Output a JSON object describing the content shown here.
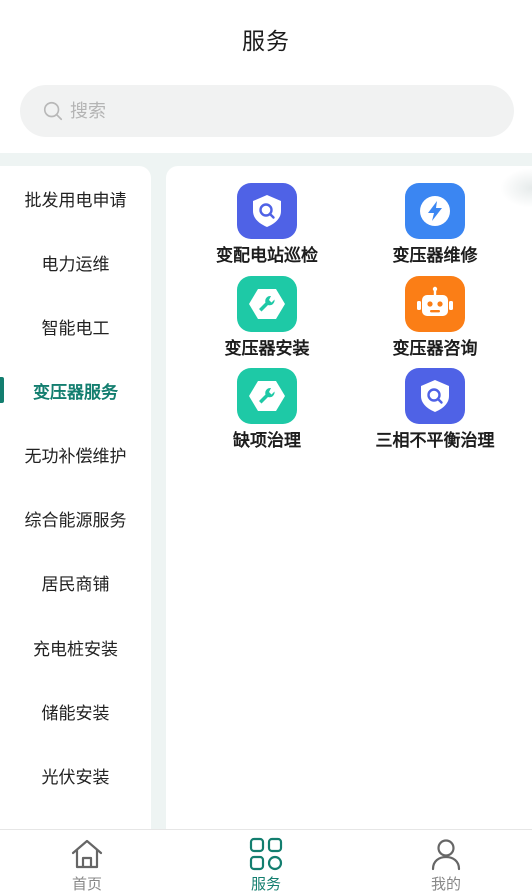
{
  "header": {
    "title": "服务"
  },
  "search": {
    "placeholder": "搜索",
    "value": ""
  },
  "sidebar": {
    "items": [
      {
        "label": "批发用电申请"
      },
      {
        "label": "电力运维"
      },
      {
        "label": "智能电工"
      },
      {
        "label": "变压器服务",
        "active": true
      },
      {
        "label": "无功补偿维护"
      },
      {
        "label": "综合能源服务"
      },
      {
        "label": "居民商铺"
      },
      {
        "label": "充电桩安装"
      },
      {
        "label": "储能安装"
      },
      {
        "label": "光伏安装"
      }
    ]
  },
  "services": [
    {
      "label": "变配电站巡检",
      "icon": "shield-search-icon",
      "color": "#4f62e6"
    },
    {
      "label": "变压器维修",
      "icon": "lightning-icon",
      "color": "#3b86f2"
    },
    {
      "label": "变压器安装",
      "icon": "wrench-icon",
      "color": "#1ec9a6"
    },
    {
      "label": "变压器咨询",
      "icon": "robot-icon",
      "color": "#fb7e16"
    },
    {
      "label": "缺项治理",
      "icon": "wrench-icon",
      "color": "#1ec9a6"
    },
    {
      "label": "三相不平衡治理",
      "icon": "shield-search-icon",
      "color": "#4f62e6"
    }
  ],
  "tabbar": {
    "items": [
      {
        "label": "首页",
        "icon": "home-icon"
      },
      {
        "label": "服务",
        "icon": "grid-icon",
        "active": true
      },
      {
        "label": "我的",
        "icon": "user-icon"
      }
    ]
  },
  "colors": {
    "accent": "#137e6f",
    "muted": "#888888"
  }
}
